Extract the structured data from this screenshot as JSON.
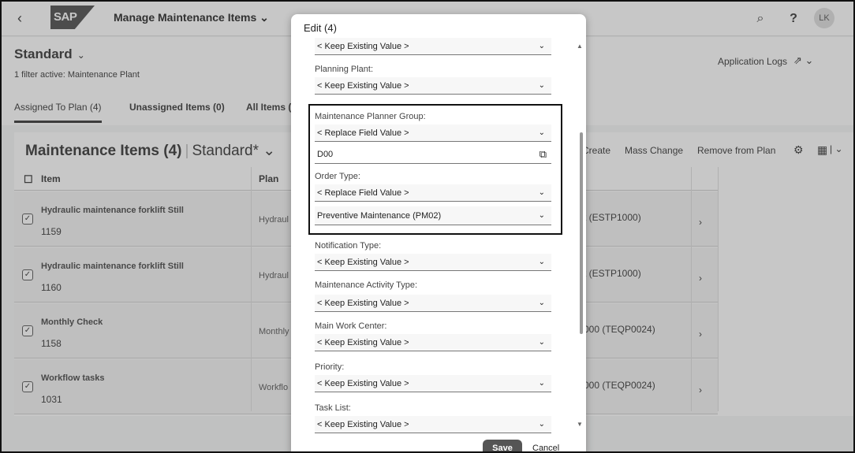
{
  "shell": {
    "back_icon": "‹",
    "logo_text": "SAP",
    "app_title": "Manage Maintenance Items ⌄",
    "search_icon": "⌕",
    "help_icon": "?",
    "avatar": "LK"
  },
  "header": {
    "variant": "Standard",
    "variant_chevron": "⌄",
    "filter_info": "1 filter active: Maintenance Plant",
    "app_logs": "Application Logs",
    "share_icon": "⇗ ⌄"
  },
  "tabs": [
    "Assigned To Plan (4)",
    "Unassigned Items (0)",
    "All Items ("
  ],
  "table": {
    "title": "Maintenance Items (4)",
    "variant": "Standard",
    "variant_suffix": "* ⌄",
    "toolbar": [
      "Create",
      "Mass Change",
      "Remove from Plan"
    ],
    "settings_icon": "⚙",
    "export_icon": "▦",
    "more_icon": "| ⌄",
    "columns": [
      "Item",
      "Plan"
    ],
    "rows": [
      {
        "title": "Hydraulic maintenance forklift Still",
        "number": "1159",
        "plan": "Hydraul",
        "work_center": "t (ESTP1000)",
        "nav": "›"
      },
      {
        "title": "Hydraulic maintenance forklift Still",
        "number": "1160",
        "plan": "Hydraul",
        "work_center": "t (ESTP1000)",
        "nav": "›"
      },
      {
        "title": "Monthly Check",
        "number": "1158",
        "plan": "Monthly",
        "work_center": "000 (TEQP0024)",
        "nav": "›"
      },
      {
        "title": "Workflow tasks",
        "number": "1031",
        "plan": "Workflo",
        "work_center": "000 (TEQP0024)",
        "nav": "›"
      }
    ]
  },
  "dialog": {
    "title": "Edit (4)",
    "fields": [
      {
        "label": "",
        "value": "< Keep Existing Value >"
      },
      {
        "label": "Planning Plant:",
        "value": "< Keep Existing Value >"
      },
      {
        "label": "Maintenance Planner Group:",
        "value": "< Replace Field Value >",
        "input_value": "D00"
      },
      {
        "label": "Order Type:",
        "value": "< Replace Field Value >",
        "second_value": "Preventive Maintenance (PM02)"
      },
      {
        "label": "Notification Type:",
        "value": "< Keep Existing Value >"
      },
      {
        "label": "Maintenance Activity Type:",
        "value": "< Keep Existing Value >"
      },
      {
        "label": "Main Work Center:",
        "value": "< Keep Existing Value >"
      },
      {
        "label": "Priority:",
        "value": "< Keep Existing Value >"
      },
      {
        "label": "Task List:",
        "value": "< Keep Existing Value >"
      }
    ],
    "dropdown_icon": "⌄",
    "value_help_icon": "⧉",
    "save": "Save",
    "cancel": "Cancel"
  }
}
